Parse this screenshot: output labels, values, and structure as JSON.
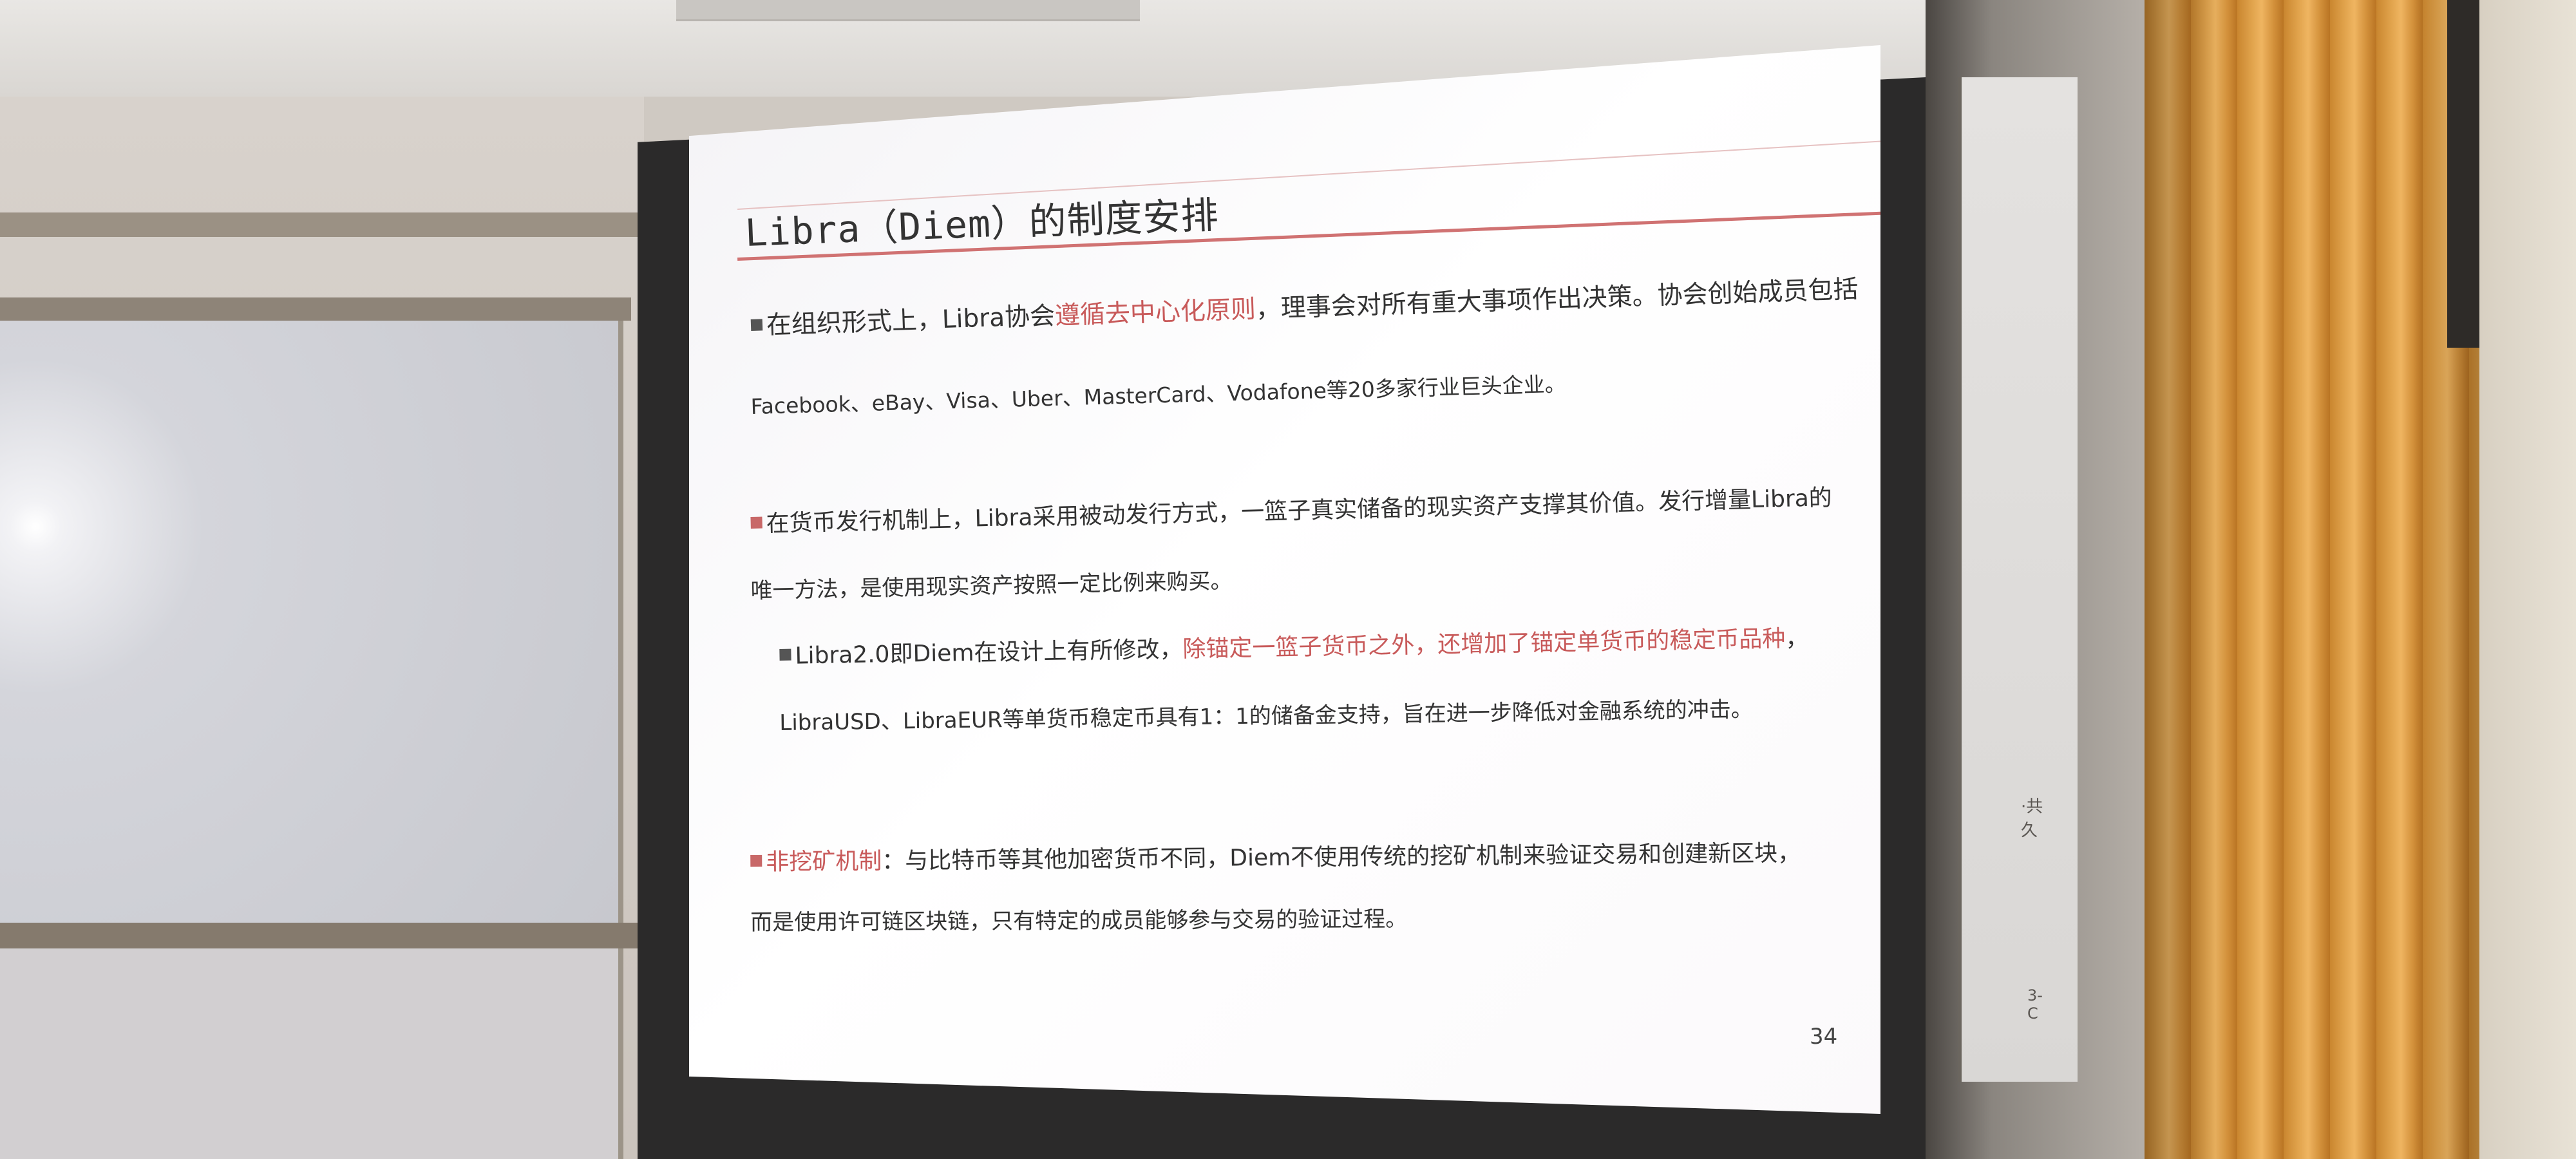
{
  "slide": {
    "title": "Libra（Diem）的制度安排",
    "page_number": "34",
    "accent_color": "#c85a5a",
    "paragraphs": [
      {
        "lead": "在组织形式上，Libra协会",
        "highlight": "遵循去中心化原则",
        "tail": "，理事会对所有重大事项作出决策。协会创始成员包括",
        "line2": "Facebook、eBay、Visa、Uber、MasterCard、Vodafone等20多家行业巨头企业。"
      },
      {
        "line1": "在货币发行机制上，Libra采用被动发行方式，一篮子真实储备的现实资产支撑其价值。发行增量Libra的",
        "line2": "唯一方法，是使用现实资产按照一定比例来购买。"
      },
      {
        "lead": "Libra2.0即Diem在设计上有所修改，",
        "highlight": "除锚定一篮子货币之外，还增加了锚定单货币的稳定币品种",
        "tail": "，",
        "line2": "LibraUSD、LibraEUR等单货币稳定币具有1：1的储备金支持，旨在进一步降低对金融系统的冲击。"
      },
      {
        "highlight": "非挖矿机制",
        "tail": "：与比特币等其他加密货币不同，Diem不使用传统的挖矿机制来验证交易和创建新区块，",
        "line2": "而是使用许可链区块链，只有特定的成员能够参与交易的验证过程。"
      }
    ]
  },
  "background": {
    "door_sign_1": "·共久",
    "door_sign_2": "3-C"
  }
}
